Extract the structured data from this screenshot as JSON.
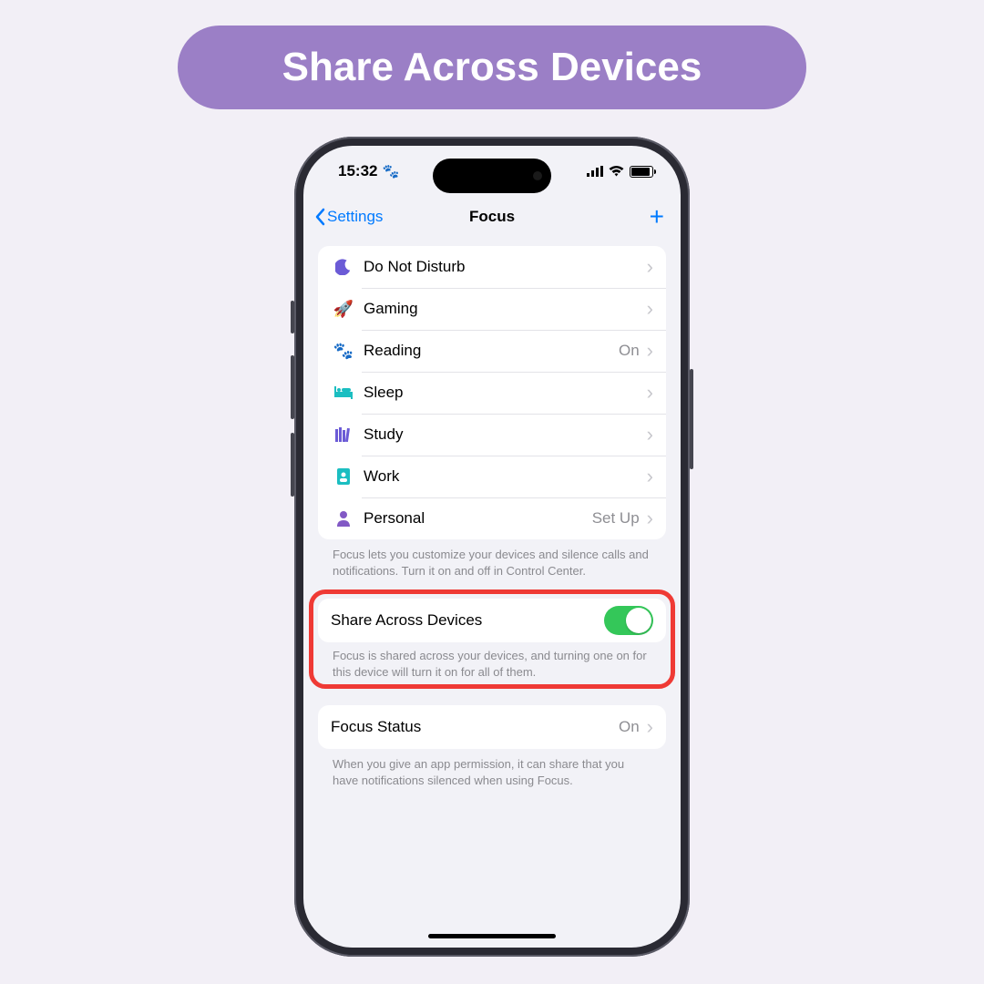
{
  "banner": {
    "title": "Share Across Devices"
  },
  "status": {
    "time": "15:32"
  },
  "nav": {
    "back": "Settings",
    "title": "Focus"
  },
  "focus": {
    "items": [
      {
        "label": "Do Not Disturb",
        "value": ""
      },
      {
        "label": "Gaming",
        "value": ""
      },
      {
        "label": "Reading",
        "value": "On"
      },
      {
        "label": "Sleep",
        "value": ""
      },
      {
        "label": "Study",
        "value": ""
      },
      {
        "label": "Work",
        "value": ""
      },
      {
        "label": "Personal",
        "value": "Set Up"
      }
    ],
    "footer": "Focus lets you customize your devices and silence calls and notifications. Turn it on and off in Control Center."
  },
  "share": {
    "label": "Share Across Devices",
    "footer": "Focus is shared across your devices, and turning one on for this device will turn it on for all of them."
  },
  "focusStatus": {
    "label": "Focus Status",
    "value": "On",
    "footer": "When you give an app permission, it can share that you have notifications silenced when using Focus."
  }
}
